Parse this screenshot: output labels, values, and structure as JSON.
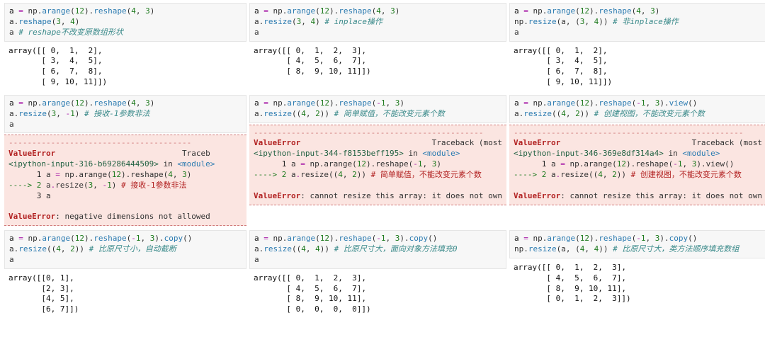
{
  "row1": {
    "c1_in": "a = np.arange(12).reshape(4, 3)\na.reshape(3, 4)\na # reshape不改变原数组形状",
    "c1_out": "array([[ 0,  1,  2],\n       [ 3,  4,  5],\n       [ 6,  7,  8],\n       [ 9, 10, 11]])",
    "c2_in": "a = np.arange(12).reshape(4, 3)\na.resize(3, 4) # inplace操作\na",
    "c2_out": "array([[ 0,  1,  2,  3],\n       [ 4,  5,  6,  7],\n       [ 8,  9, 10, 11]])",
    "c3_in": "a = np.arange(12).reshape(4, 3)\nnp.resize(a, (3, 4)) # 非inplace操作\na",
    "c3_out": "array([[ 0,  1,  2],\n       [ 3,  4,  5],\n       [ 6,  7,  8],\n       [ 9, 10, 11]])"
  },
  "row2": {
    "c1_in": "a = np.arange(12).reshape(4, 3)\na.resize(3, -1) # 接收-1参数非法\na",
    "c1_err_dash": "---------------------------------------",
    "c1_err_hdr": "ValueError                           Traceb",
    "c1_err_loc": "<ipython-input-316-b69286444509> in <module>",
    "c1_err_l1": "      1 a = np.arange(12).reshape(4, 3)",
    "c1_err_l2": "----> 2 a.resize(3, -1) # 接收-1参数非法",
    "c1_err_l3": "      3 a",
    "c1_err_msg": "ValueError: negative dimensions not allowed",
    "c2_in": "a = np.arange(12).reshape(-1, 3)\na.resize((4, 2)) # 简单赋值，不能改变元素个数",
    "c2_err_dash": "-------------------------------------------------",
    "c2_err_hdr": "ValueError                            Traceback (most ",
    "c2_err_loc": "<ipython-input-344-f8153beff195> in <module>",
    "c2_err_l1": "      1 a = np.arange(12).reshape(-1, 3)",
    "c2_err_l2": "----> 2 a.resize((4, 2)) # 简单赋值，不能改变元素个数",
    "c2_err_msg": "ValueError: cannot resize this array: it does not own its",
    "c3_in": "a = np.arange(12).reshape(-1, 3).view()\na.resize((4, 2)) # 创建视图，不能改变元素个数",
    "c3_err_dash": "-------------------------------------------------",
    "c3_err_hdr": "ValueError                            Traceback (most",
    "c3_err_loc": "<ipython-input-346-369e8df314a4> in <module>",
    "c3_err_l1": "      1 a = np.arange(12).reshape(-1, 3).view()",
    "c3_err_l2": "----> 2 a.resize((4, 2)) # 创建视图，不能改变元素个数",
    "c3_err_msg": "ValueError: cannot resize this array: it does not own its"
  },
  "row3": {
    "c1_in": "a = np.arange(12).reshape(-1, 3).copy()\na.resize((4, 2)) # 比原尺寸小，自动截断\na",
    "c1_out": "array([[0, 1],\n       [2, 3],\n       [4, 5],\n       [6, 7]])",
    "c2_in": "a = np.arange(12).reshape(-1, 3).copy()\na.resize((4, 4)) # 比原尺寸大，面向对象方法填充0\na",
    "c2_out": "array([[ 0,  1,  2,  3],\n       [ 4,  5,  6,  7],\n       [ 8,  9, 10, 11],\n       [ 0,  0,  0,  0]])",
    "c3_in": "a = np.arange(12).reshape(-1, 3).copy()\nnp.resize(a, (4, 4)) # 比原尺寸大，类方法顺序填充数组",
    "c3_out": "array([[ 0,  1,  2,  3],\n       [ 4,  5,  6,  7],\n       [ 8,  9, 10, 11],\n       [ 0,  1,  2,  3]])"
  }
}
